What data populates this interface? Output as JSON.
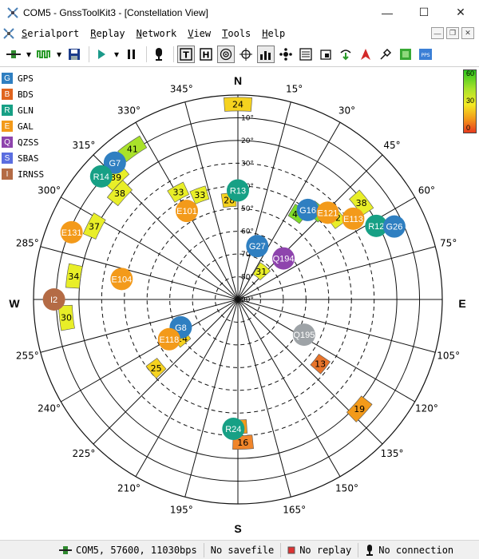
{
  "window": {
    "title": "COM5 - GnssToolKit3 - [Constellation View]"
  },
  "menu": [
    "Serialport",
    "Replay",
    "Network",
    "View",
    "Tools",
    "Help"
  ],
  "legend": [
    {
      "code": "G",
      "name": "GPS",
      "color": "#2f7fc1"
    },
    {
      "code": "B",
      "name": "BDS",
      "color": "#e0641e"
    },
    {
      "code": "R",
      "name": "GLN",
      "color": "#17a085"
    },
    {
      "code": "E",
      "name": "GAL",
      "color": "#f39a1a"
    },
    {
      "code": "Q",
      "name": "QZSS",
      "color": "#8e44ad"
    },
    {
      "code": "S",
      "name": "SBAS",
      "color": "#5b6ee0"
    },
    {
      "code": "I",
      "name": "IRNSS",
      "color": "#b46b45"
    }
  ],
  "colorbar": {
    "top": "60",
    "mid": "30",
    "bottom": "0"
  },
  "compass": {
    "n": "N",
    "e": "E",
    "s": "S",
    "w": "W"
  },
  "azimuth_labels": [
    "15°",
    "30°",
    "45°",
    "60°",
    "75°",
    "105°",
    "120°",
    "135°",
    "150°",
    "165°",
    "195°",
    "210°",
    "225°",
    "240°",
    "255°",
    "285°",
    "300°",
    "315°",
    "330°",
    "345°"
  ],
  "elevation_labels": [
    "10°",
    "20°",
    "30°",
    "40°",
    "50°",
    "60°",
    "70°",
    "80°",
    "90°"
  ],
  "chart_data": {
    "type": "scatter",
    "title": "",
    "satellites": [
      {
        "id": "G7",
        "sys": "G",
        "az": 318,
        "el": 9
      },
      {
        "id": "R14",
        "sys": "R",
        "az": 312,
        "el": 9
      },
      {
        "id": "R13",
        "sys": "R",
        "az": 0,
        "el": 42
      },
      {
        "id": "E101",
        "sys": "E",
        "az": 330,
        "el": 45
      },
      {
        "id": "G16",
        "sys": "G",
        "az": 38,
        "el": 40
      },
      {
        "id": "E121",
        "sys": "E",
        "az": 46,
        "el": 35
      },
      {
        "id": "E113",
        "sys": "E",
        "az": 55,
        "el": 28
      },
      {
        "id": "R12",
        "sys": "R",
        "az": 62,
        "el": 21
      },
      {
        "id": "G26",
        "sys": "G",
        "az": 65,
        "el": 14
      },
      {
        "id": "G27",
        "sys": "G",
        "az": 20,
        "el": 65
      },
      {
        "id": "Q194",
        "sys": "Q",
        "az": 48,
        "el": 63
      },
      {
        "id": "E131",
        "sys": "E",
        "az": 292,
        "el": 11
      },
      {
        "id": "E104",
        "sys": "E",
        "az": 280,
        "el": 38
      },
      {
        "id": "I2",
        "sys": "I",
        "az": 270,
        "el": 9
      },
      {
        "id": "G8",
        "sys": "G",
        "az": 244,
        "el": 62
      },
      {
        "id": "E118",
        "sys": "E",
        "az": 240,
        "el": 55
      },
      {
        "id": "Q195",
        "sys": "S",
        "az": 118,
        "el": 57
      },
      {
        "id": "R24",
        "sys": "R",
        "az": 182,
        "el": 33
      }
    ],
    "snr_boxes": [
      {
        "snr": "24",
        "az": 0,
        "el": 4,
        "color": "#f5d21f"
      },
      {
        "snr": "41",
        "az": 325,
        "el": 9,
        "color": "#a9e22a"
      },
      {
        "snr": "39",
        "az": 315,
        "el": 14,
        "color": "#e8ee28"
      },
      {
        "snr": "38",
        "az": 312,
        "el": 20,
        "color": "#e8ee28"
      },
      {
        "snr": "33",
        "az": 340,
        "el": 41,
        "color": "#e8ee28"
      },
      {
        "snr": "33",
        "az": 331,
        "el": 36,
        "color": "#e8ee28"
      },
      {
        "snr": "28",
        "az": 355,
        "el": 46,
        "color": "#f5d21f"
      },
      {
        "snr": "44",
        "az": 35,
        "el": 44,
        "color": "#7fdc28"
      },
      {
        "snr": "45",
        "az": 42,
        "el": 38,
        "color": "#7fdc28"
      },
      {
        "snr": "32",
        "az": 50,
        "el": 34,
        "color": "#e8ee28"
      },
      {
        "snr": "38",
        "az": 52,
        "el": 21,
        "color": "#e8ee28"
      },
      {
        "snr": "31",
        "az": 40,
        "el": 74,
        "color": "#e8ee28"
      },
      {
        "snr": "37",
        "az": 297,
        "el": 19,
        "color": "#e8ee28"
      },
      {
        "snr": "34",
        "az": 278,
        "el": 17,
        "color": "#e8ee28"
      },
      {
        "snr": "30",
        "az": 264,
        "el": 14,
        "color": "#e8ee28"
      },
      {
        "snr": "24",
        "az": 235,
        "el": 60,
        "color": "#f5d21f"
      },
      {
        "snr": "25",
        "az": 230,
        "el": 43,
        "color": "#f5d21f"
      },
      {
        "snr": "13",
        "az": 128,
        "el": 44,
        "color": "#e8742a"
      },
      {
        "snr": "19",
        "az": 132,
        "el": 18,
        "color": "#f39a1a"
      },
      {
        "snr": "20",
        "az": 180,
        "el": 34,
        "color": "#f39a1a"
      },
      {
        "snr": "16",
        "az": 178,
        "el": 27,
        "color": "#f0852a"
      }
    ]
  },
  "status": {
    "port": "COM5, 57600, 11030bps",
    "savefile": "No savefile",
    "replay": "No replay",
    "connection": "No connection"
  }
}
